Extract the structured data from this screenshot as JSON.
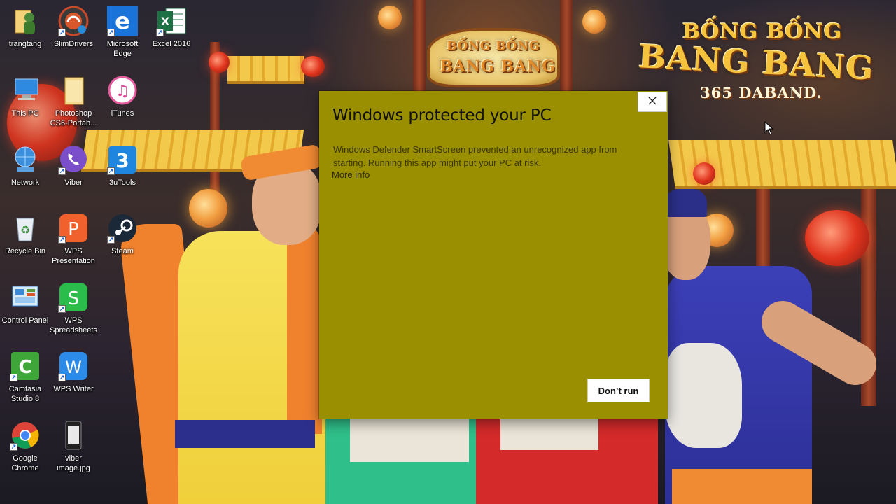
{
  "desktop": {
    "icons": [
      {
        "label": "trangtang",
        "icon": "user-folder-icon"
      },
      {
        "label": "SlimDrivers",
        "icon": "slimdrivers-icon"
      },
      {
        "label": "Microsoft Edge",
        "icon": "edge-icon"
      },
      {
        "label": "Excel 2016",
        "icon": "excel-icon"
      },
      {
        "label": "This PC",
        "icon": "computer-icon"
      },
      {
        "label": "Photoshop CS6-Portab...",
        "icon": "folder-icon"
      },
      {
        "label": "iTunes",
        "icon": "itunes-icon"
      },
      {
        "label": "Network",
        "icon": "network-icon"
      },
      {
        "label": "Viber",
        "icon": "viber-icon"
      },
      {
        "label": "3uTools",
        "icon": "3utools-icon"
      },
      {
        "label": "Recycle Bin",
        "icon": "recycle-bin-icon"
      },
      {
        "label": "WPS Presentation",
        "icon": "wps-presentation-icon"
      },
      {
        "label": "Steam",
        "icon": "steam-icon"
      },
      {
        "label": "Control Panel",
        "icon": "control-panel-icon"
      },
      {
        "label": "WPS Spreadsheets",
        "icon": "wps-spreadsheets-icon"
      },
      {
        "label": "Camtasia Studio 8",
        "icon": "camtasia-icon"
      },
      {
        "label": "WPS Writer",
        "icon": "wps-writer-icon"
      },
      {
        "label": "Google Chrome",
        "icon": "chrome-icon"
      },
      {
        "label": "viber image.jpg",
        "icon": "image-file-icon"
      }
    ]
  },
  "wallpaper": {
    "logo_line1": "BỐNG BỐNG",
    "logo_line2": "BANG BANG",
    "logo_line3": "365 DABAND.",
    "sign_line1": "BỐNG BỐNG",
    "sign_line2": "BANG BANG"
  },
  "dialog": {
    "title": "Windows protected your PC",
    "body": "Windows Defender SmartScreen prevented an unrecognized app from starting. Running this app might put your PC at risk.",
    "more_info": "More info",
    "dont_run_label": "Don’t run",
    "close_icon": "close-icon",
    "background_color": "#9a8f00"
  }
}
